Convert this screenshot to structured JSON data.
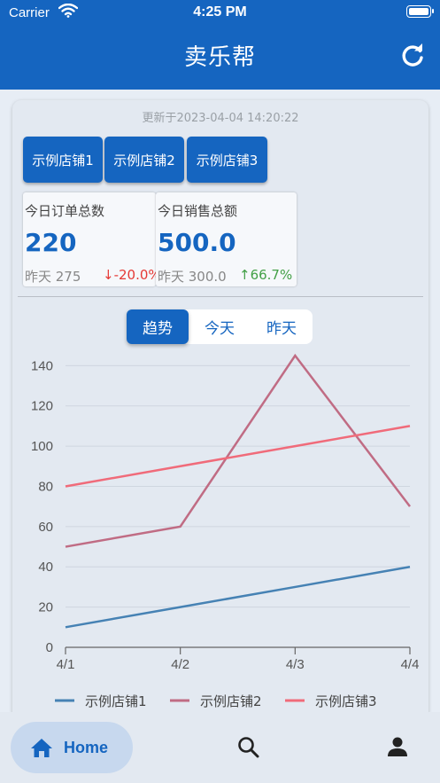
{
  "status": {
    "carrier": "Carrier",
    "time": "4:25 PM"
  },
  "appbar": {
    "title": "卖乐帮"
  },
  "updated": "更新于2023-04-04 14:20:22",
  "shops": [
    "示例店铺1",
    "示例店铺2",
    "示例店铺3"
  ],
  "stats": [
    {
      "label": "今日订单总数",
      "value": "220",
      "prev": "昨天 275",
      "change": "-20.0%",
      "direction": "down"
    },
    {
      "label": "今日销售总额",
      "value": "500.0",
      "prev": "昨天 300.0",
      "change": "66.7%",
      "direction": "up"
    }
  ],
  "tabs": [
    {
      "label": "趋势",
      "active": true
    },
    {
      "label": "今天",
      "active": false
    },
    {
      "label": "昨天",
      "active": false
    }
  ],
  "chart_data": {
    "type": "line",
    "categories": [
      "4/1",
      "4/2",
      "4/3",
      "4/4"
    ],
    "ylim": [
      0,
      145
    ],
    "yticks": [
      0,
      20,
      40,
      60,
      80,
      100,
      120,
      140
    ],
    "series": [
      {
        "name": "示例店铺1",
        "values": [
          10,
          20,
          30,
          40
        ],
        "color": "#4682b4"
      },
      {
        "name": "示例店铺2",
        "values": [
          50,
          60,
          145,
          70
        ],
        "color": "#c06c84"
      },
      {
        "name": "示例店铺3",
        "values": [
          80,
          90,
          100,
          110
        ],
        "color": "#f06b7a"
      }
    ]
  },
  "nav": {
    "home_label": "Home",
    "colors": {
      "primary": "#1565c0"
    }
  }
}
